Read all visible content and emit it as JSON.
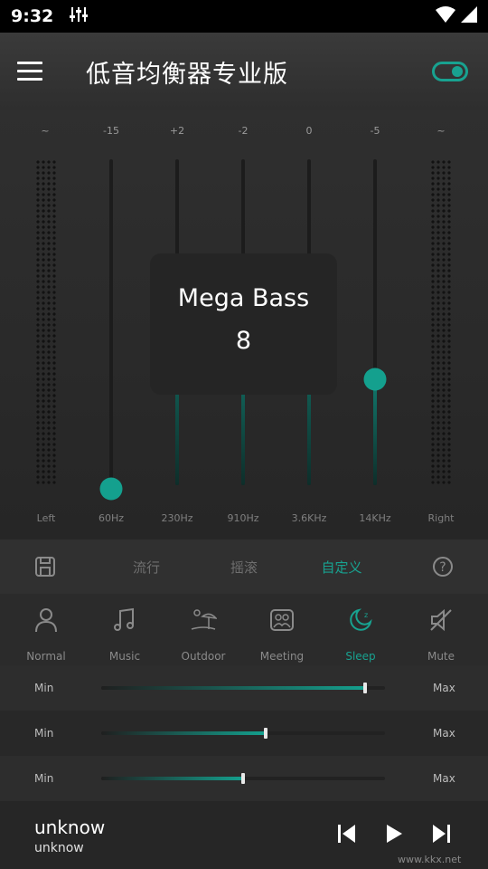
{
  "status": {
    "time": "9:32"
  },
  "header": {
    "title": "低音均衡器专业版",
    "toggle_on": true
  },
  "accent": "#18a290",
  "eq": {
    "left_cap": "~",
    "right_cap": "~",
    "bands": [
      {
        "label": "60Hz",
        "value": "-15",
        "level": 0.0
      },
      {
        "label": "230Hz",
        "value": "+2",
        "level": 0.55
      },
      {
        "label": "910Hz",
        "value": "-2",
        "level": 0.45
      },
      {
        "label": "3.6KHz",
        "value": "0",
        "level": 0.5
      },
      {
        "label": "14KHz",
        "value": "-5",
        "level": 0.33
      }
    ],
    "left_label": "Left",
    "right_label": "Right"
  },
  "popup": {
    "name": "Mega Bass",
    "value": "8"
  },
  "presets": {
    "items": [
      "流行",
      "摇滚",
      "自定义"
    ],
    "active_index": 2
  },
  "modes": [
    {
      "label": "Normal",
      "icon": "person-icon"
    },
    {
      "label": "Music",
      "icon": "music-note-icon"
    },
    {
      "label": "Outdoor",
      "icon": "beach-icon"
    },
    {
      "label": "Meeting",
      "icon": "meeting-icon"
    },
    {
      "label": "Sleep",
      "icon": "moon-icon",
      "active": true
    },
    {
      "label": "Mute",
      "icon": "mute-icon"
    }
  ],
  "sliders": [
    {
      "min": "Min",
      "max": "Max",
      "level": 0.93
    },
    {
      "min": "Min",
      "max": "Max",
      "level": 0.58
    },
    {
      "min": "Min",
      "max": "Max",
      "level": 0.5
    }
  ],
  "player": {
    "title": "unknow",
    "artist": "unknow"
  },
  "watermark": "www.kkx.net"
}
